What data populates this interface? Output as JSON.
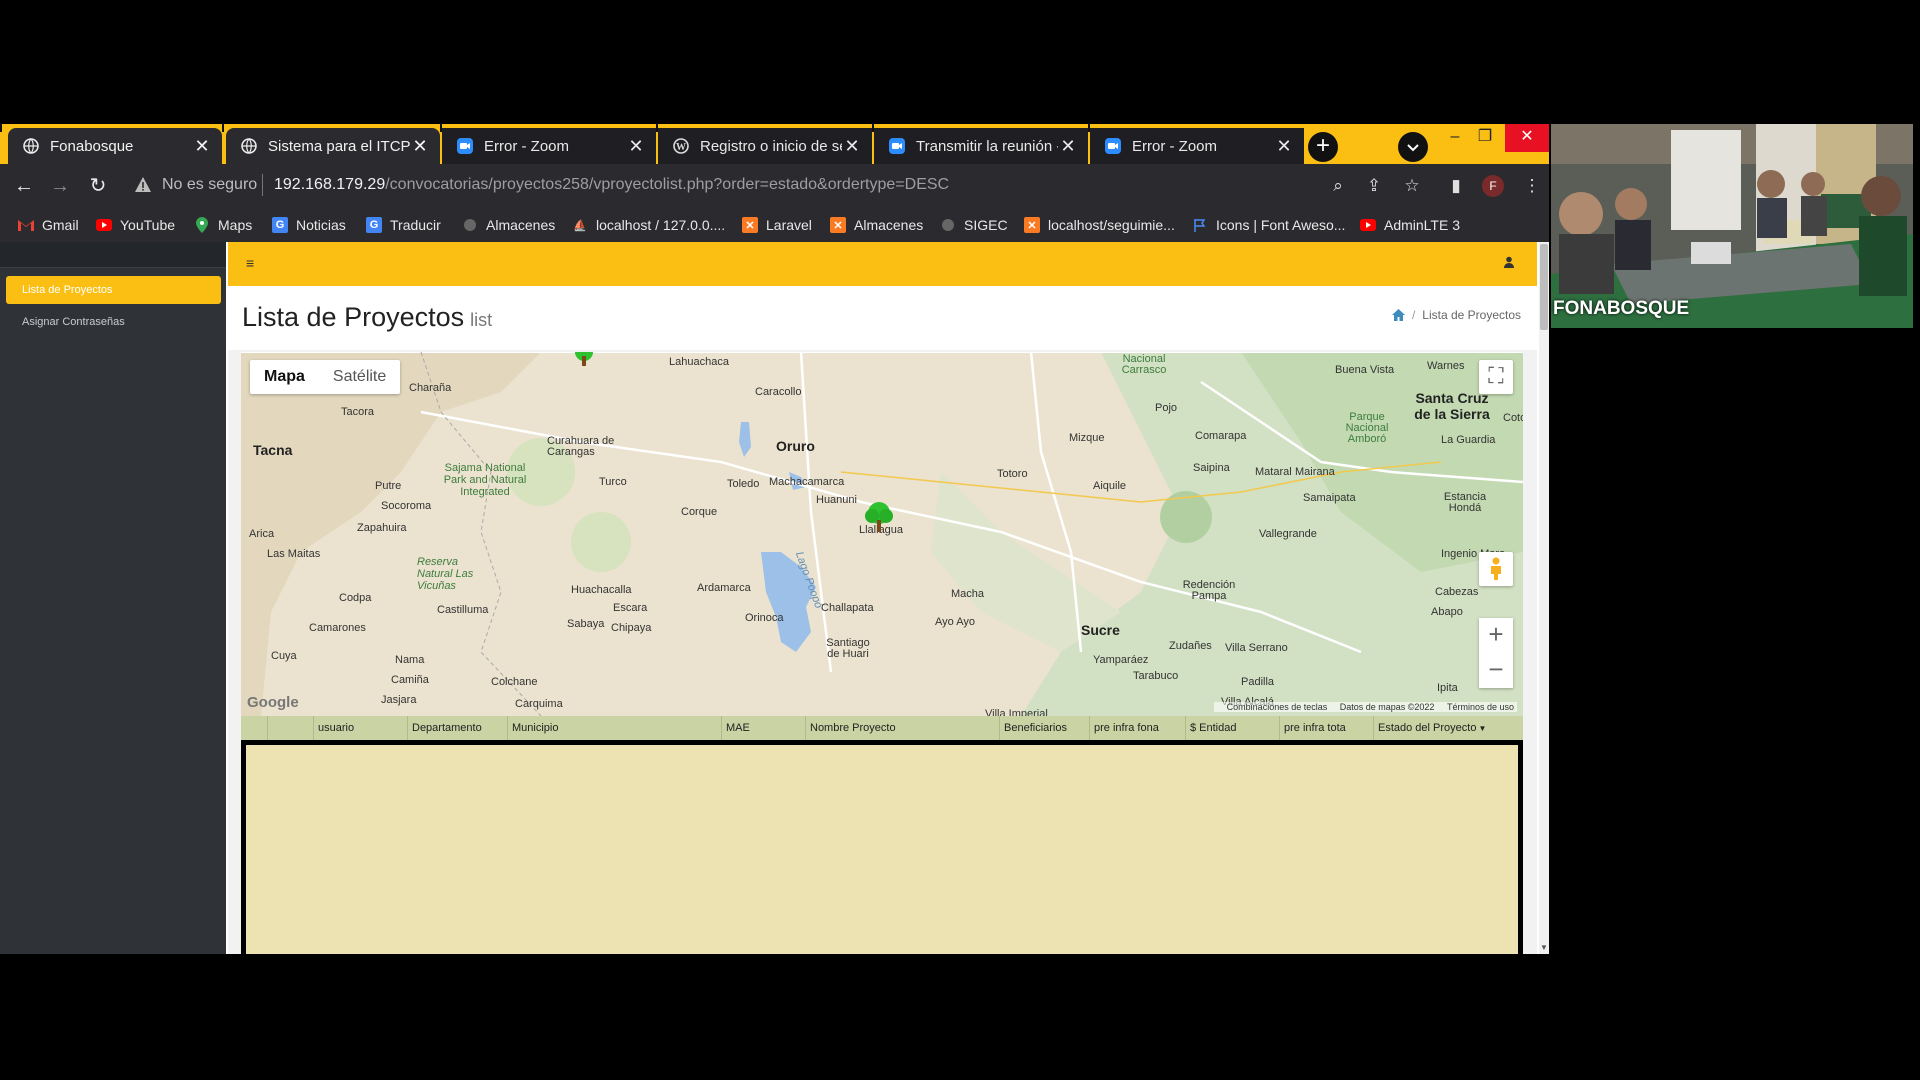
{
  "browser": {
    "tabs": [
      {
        "title": "Fonabosque",
        "state": "inactive",
        "icon": "globe-icon"
      },
      {
        "title": "Sistema para el ITCP",
        "state": "active",
        "icon": "globe-icon"
      },
      {
        "title": "Error - Zoom",
        "state": "inactive",
        "icon": "zoom-icon"
      },
      {
        "title": "Registro o inicio de ses",
        "state": "inactive",
        "icon": "wordpress-icon"
      },
      {
        "title": "Transmitir la reunión - ",
        "state": "inactive",
        "icon": "zoom-icon"
      },
      {
        "title": "Error - Zoom",
        "state": "inactive",
        "icon": "zoom-icon"
      }
    ],
    "address": {
      "security_label": "No es seguro",
      "host": "192.168.179.29",
      "path": "/convocatorias/proyectos258/vproyectolist.php?order=estado&ordertype=DESC"
    },
    "profile_initial": "F",
    "bookmarks": [
      {
        "label": "Gmail",
        "icon": "gmail-icon"
      },
      {
        "label": "YouTube",
        "icon": "youtube-icon"
      },
      {
        "label": "Maps",
        "icon": "maps-pin-icon"
      },
      {
        "label": "Noticias",
        "icon": "news-icon"
      },
      {
        "label": "Traducir",
        "icon": "translate-icon"
      },
      {
        "label": "Almacenes",
        "icon": "globe-icon"
      },
      {
        "label": "localhost / 127.0.0....",
        "icon": "phpmyadmin-icon"
      },
      {
        "label": "Laravel",
        "icon": "xampp-icon"
      },
      {
        "label": "Almacenes",
        "icon": "xampp-icon"
      },
      {
        "label": "SIGEC",
        "icon": "globe-icon"
      },
      {
        "label": "localhost/seguimie...",
        "icon": "xampp-icon"
      },
      {
        "label": "Icons | Font Aweso...",
        "icon": "flag-icon"
      },
      {
        "label": "AdminLTE 3",
        "icon": "youtube-icon"
      }
    ]
  },
  "sidebar": {
    "items": [
      {
        "label": "Lista de Proyectos",
        "active": true
      },
      {
        "label": "Asignar Contraseñas",
        "active": false
      }
    ]
  },
  "header": {
    "title": "Lista de Proyectos",
    "subtitle": "list",
    "breadcrumb": "Lista de Proyectos"
  },
  "map": {
    "type_buttons": [
      "Mapa",
      "Satélite"
    ],
    "google": "Google",
    "attribution": [
      "Combinaciones de teclas",
      "Datos de mapas ©2022",
      "Términos de uso"
    ],
    "places": {
      "tacna": "Tacna",
      "charana": "Charaña",
      "tacora": "Tacora",
      "lahuachaca": "Lahuachaca",
      "caracollo": "Caracollo",
      "oruro": "Oruro",
      "curahuara": "Curahuara de Carangas",
      "sajama": "Sajama National Park and Natural Integrated",
      "putre": "Putre",
      "socoroma": "Socoroma",
      "zapahuira": "Zapahuira",
      "arica": "Arica",
      "las_maitas": "Las Maitas",
      "reserva": "Reserva Natural Las Vicuñas",
      "codpa": "Codpa",
      "castilluma": "Castilluma",
      "camarones": "Camarones",
      "cuya": "Cuya",
      "nama": "Nama",
      "camina": "Camiña",
      "jasjara": "Jasjara",
      "colchane": "Colchane",
      "carquima": "Carquima",
      "turco": "Turco",
      "corque": "Corque",
      "toledo": "Toledo",
      "machacamarca": "Machacamarca",
      "huanuni": "Huanuni",
      "llallagua": "Llallagua",
      "huachacalla": "Huachacalla",
      "escara": "Escara",
      "sabaya": "Sabaya",
      "chipaya": "Chipaya",
      "ardamarca": "Ardamarca",
      "orinoca": "Orinoca",
      "lago_poopo": "Lago Poopó",
      "challapata": "Challapata",
      "santiago": "Santiago de Huari",
      "macha": "Macha",
      "ayo_ayo": "Ayo Ayo",
      "mizque": "Mizque",
      "totoro": "Totoro",
      "aiquile": "Aiquile",
      "pojo": "Pojo",
      "comarapa": "Comarapa",
      "carrasco": "Nacional Carrasco",
      "saipina": "Saipina",
      "mataral": "Mataral",
      "mairana": "Mairana",
      "samaipata": "Samaipata",
      "vallegrande": "Vallegrande",
      "santa_cruz": "Santa Cruz de la Sierra",
      "warnes": "Warnes",
      "buena_vista": "Buena Vista",
      "la_guardia": "La Guardia",
      "amboro": "Parque Nacional Amboró",
      "coto": "Coto",
      "estancia": "Estancia Hondá",
      "ingenio": "Ingenio Mora",
      "cabezas": "Cabezas",
      "abapo": "Abapo",
      "redencion": "Redención Pampa",
      "sucre": "Sucre",
      "zudanes": "Zudañes",
      "villa_serrano": "Villa Serrano",
      "yamparaez": "Yamparáez",
      "tarabuco": "Tarabuco",
      "padilla": "Padilla",
      "ipita": "Ipita",
      "villa_alcala": "Villa Alcalá",
      "villa_imperial": "Villa Imperial"
    }
  },
  "table": {
    "columns": [
      "",
      "",
      "usuario",
      "Departamento",
      "Municipio",
      "MAE",
      "Nombre Proyecto",
      "Beneficiarios",
      "pre infra fona",
      "$ Entidad",
      "pre infra tota",
      "Estado del Proyecto"
    ]
  },
  "video": {
    "label": "FONABOSQUE"
  },
  "colors": {
    "accent": "#fbbf14",
    "sidebar": "#2f3338",
    "table_header": "#c9d3a4",
    "table_body": "#ede2b2"
  }
}
